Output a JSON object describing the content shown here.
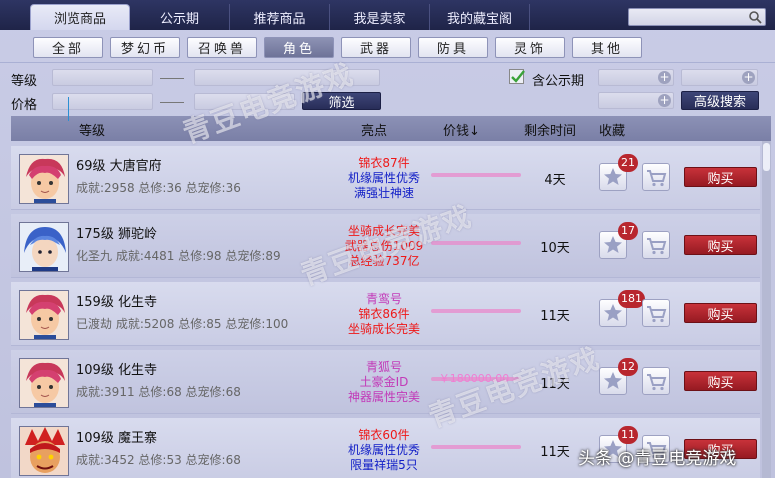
{
  "nav": {
    "tabs": [
      "浏览商品",
      "公示期",
      "推荐商品",
      "我是卖家",
      "我的藏宝阁"
    ],
    "active": 0,
    "search_placeholder": ""
  },
  "categories": {
    "items": [
      "全部",
      "梦幻币",
      "召唤兽",
      "角色",
      "武器",
      "防具",
      "灵饰",
      "其他"
    ],
    "active": 3
  },
  "filters": {
    "level_label": "等级",
    "price_label": "价格",
    "filter_button": "筛选",
    "public_label": "含公示期",
    "public_checked": true,
    "advanced_button": "高级搜索"
  },
  "table": {
    "headers": {
      "level": "等级",
      "highlight": "亮点",
      "price": "价钱↓",
      "time": "剩余时间",
      "fav": "收藏"
    },
    "buy_label": "购买",
    "rows": [
      {
        "name": "69级 大唐官府",
        "stats": "成就:2958 总修:36 总宠修:36",
        "highlights": [
          {
            "text": "锦衣87件",
            "color": "red"
          },
          {
            "text": "机缘属性优秀",
            "color": "blue"
          },
          {
            "text": "满强壮神速",
            "color": "blue"
          }
        ],
        "price": "",
        "days": "4天",
        "fav_count": "21",
        "avatar": "boy-red"
      },
      {
        "name": "175级 狮驼岭",
        "stats": "化圣九 成就:4481 总修:98 总宠修:89",
        "highlights": [
          {
            "text": "坐骑成长完美",
            "color": "red"
          },
          {
            "text": "武器总伤1009",
            "color": "red"
          },
          {
            "text": "总经验737亿",
            "color": "red"
          }
        ],
        "price": "",
        "days": "10天",
        "fav_count": "17",
        "avatar": "blue-hair"
      },
      {
        "name": "159级 化生寺",
        "stats": "已渡劫 成就:5208 总修:85 总宠修:100",
        "highlights": [
          {
            "text": "青鸾号",
            "color": "pink"
          },
          {
            "text": "锦衣86件",
            "color": "red"
          },
          {
            "text": "坐骑成长完美",
            "color": "red"
          }
        ],
        "price": "",
        "days": "11天",
        "fav_count": "181",
        "avatar": "boy-red"
      },
      {
        "name": "109级 化生寺",
        "stats": "成就:3911 总修:68 总宠修:68",
        "highlights": [
          {
            "text": "青狐号",
            "color": "pink"
          },
          {
            "text": "土豪金ID",
            "color": "pink"
          },
          {
            "text": "神器属性完美",
            "color": "pink"
          }
        ],
        "price": "￥180000.00",
        "days": "11天",
        "fav_count": "12",
        "avatar": "boy-red"
      },
      {
        "name": "109级 魔王寨",
        "stats": "成就:3452 总修:53 总宠修:68",
        "highlights": [
          {
            "text": "锦衣60件",
            "color": "red"
          },
          {
            "text": "机缘属性优秀",
            "color": "blue"
          },
          {
            "text": "限量祥瑞5只",
            "color": "blue"
          }
        ],
        "price": "",
        "days": "11天",
        "fav_count": "11",
        "avatar": "demon"
      }
    ]
  },
  "watermarks": [
    "青豆电竞游戏",
    "青豆电竞游戏",
    "青豆电竞游戏"
  ],
  "credit": "头条 @青豆电竞游戏"
}
